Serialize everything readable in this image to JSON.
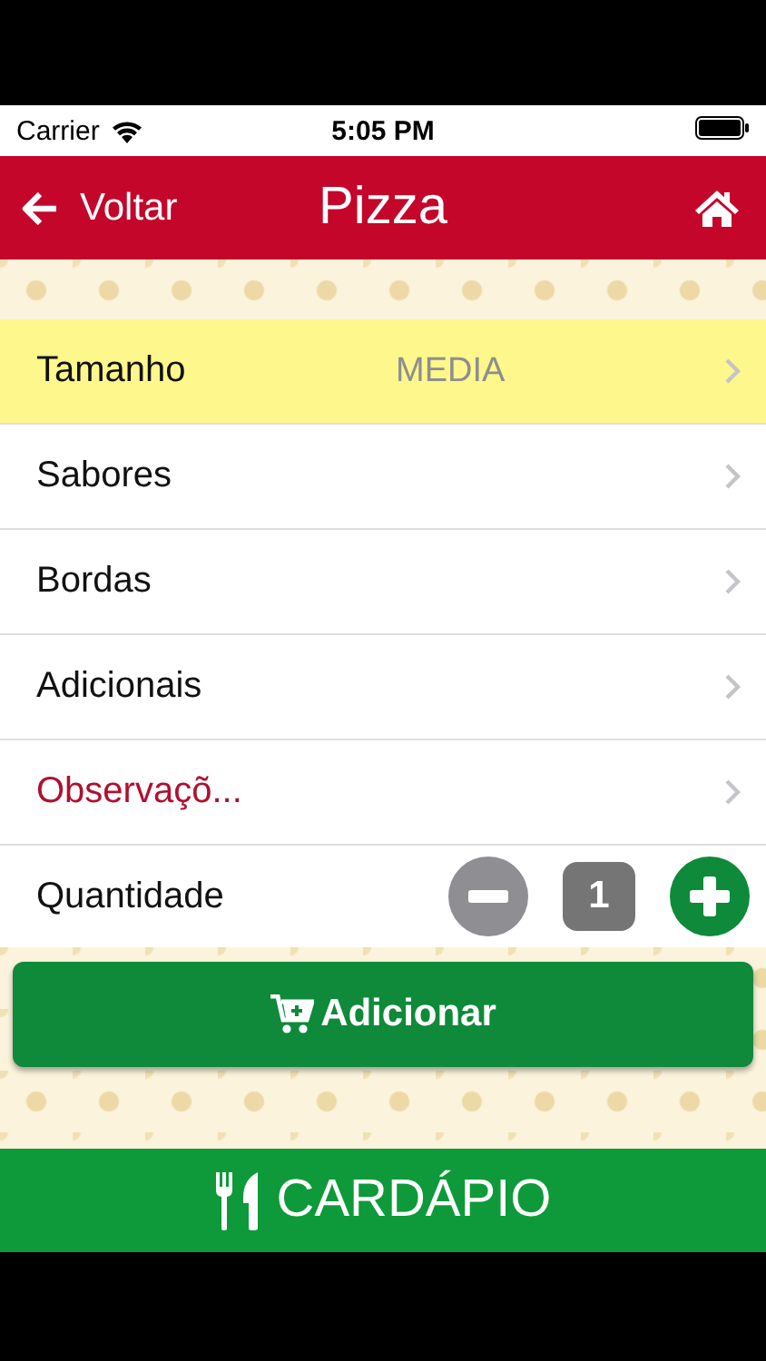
{
  "status_bar": {
    "carrier": "Carrier",
    "time": "5:05 PM"
  },
  "header": {
    "back_label": "Voltar",
    "title": "Pizza"
  },
  "options": [
    {
      "kind": "option",
      "label": "Tamanho",
      "value": "MEDIA",
      "selected": true,
      "emphasized": false
    },
    {
      "kind": "option",
      "label": "Sabores",
      "selected": false,
      "emphasized": false
    },
    {
      "kind": "option",
      "label": "Bordas",
      "selected": false,
      "emphasized": false
    },
    {
      "kind": "option",
      "label": "Adicionais",
      "selected": false,
      "emphasized": false
    },
    {
      "kind": "option",
      "label": "Observaçõ...",
      "selected": false,
      "emphasized": true
    },
    {
      "kind": "quantity",
      "label": "Quantidade",
      "value": "1"
    }
  ],
  "add_button": {
    "label": "Adicionar"
  },
  "footer": {
    "label": "CARDÁPIO"
  }
}
